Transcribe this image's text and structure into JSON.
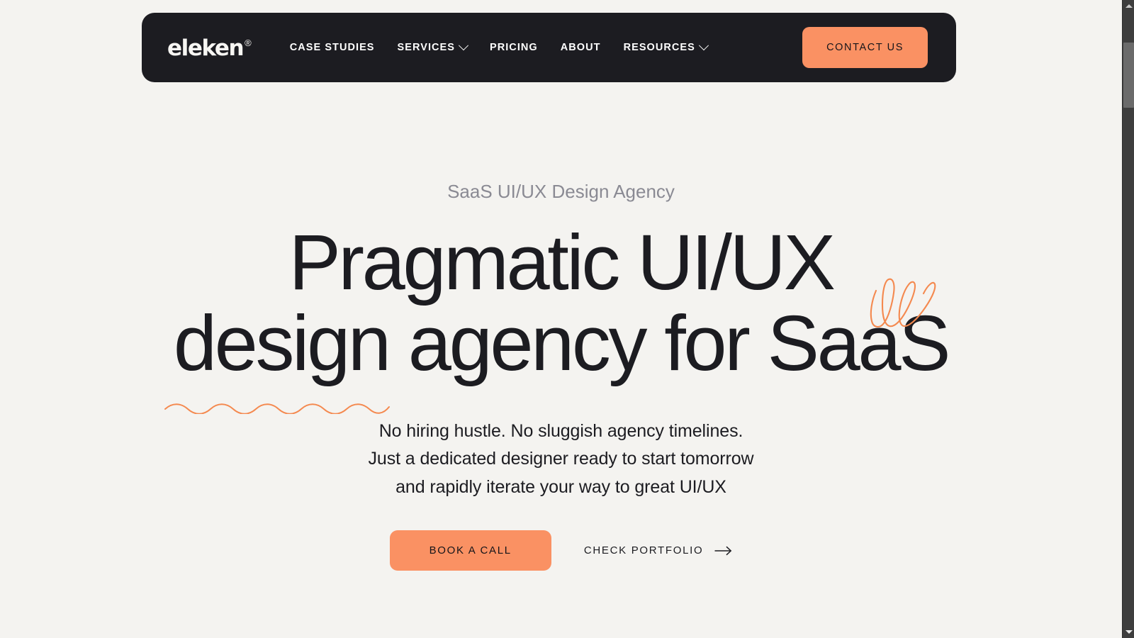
{
  "theme": {
    "background": "#F4F3F0",
    "nav_background": "#1C1C21",
    "accent": "#FA9163",
    "text_dark": "#1C1C21",
    "text_muted": "#8A8A93",
    "text_light": "#FFFFFF"
  },
  "navbar": {
    "logo_text": "eleken",
    "logo_mark": "®",
    "links": [
      {
        "label": "CASE STUDIES",
        "has_dropdown": false
      },
      {
        "label": "SERVICES",
        "has_dropdown": true
      },
      {
        "label": "PRICING",
        "has_dropdown": false
      },
      {
        "label": "ABOUT",
        "has_dropdown": false
      },
      {
        "label": "RESOURCES",
        "has_dropdown": true
      }
    ],
    "cta_label": "CONTACT US"
  },
  "hero": {
    "eyebrow": "SaaS UI/UX Design Agency",
    "headline_line_1": "Pragmatic UI/UX",
    "headline_line_2": "design agency for SaaS",
    "subtext_line_1": "No hiring hustle. No sluggish agency timelines.",
    "subtext_line_2": "Just a dedicated designer ready to start tomorrow",
    "subtext_line_3": "and rapidly iterate your way to great UI/UX",
    "primary_cta": "BOOK A CALL",
    "secondary_cta": "CHECK PORTFOLIO"
  },
  "decorations": {
    "scribble_name": "orange-loop-scribble",
    "squiggle_name": "orange-wavy-underline",
    "arrow_name": "arrow-right-icon"
  },
  "scrollbar": {
    "up_arrow": "▲",
    "down_arrow": "▼"
  }
}
